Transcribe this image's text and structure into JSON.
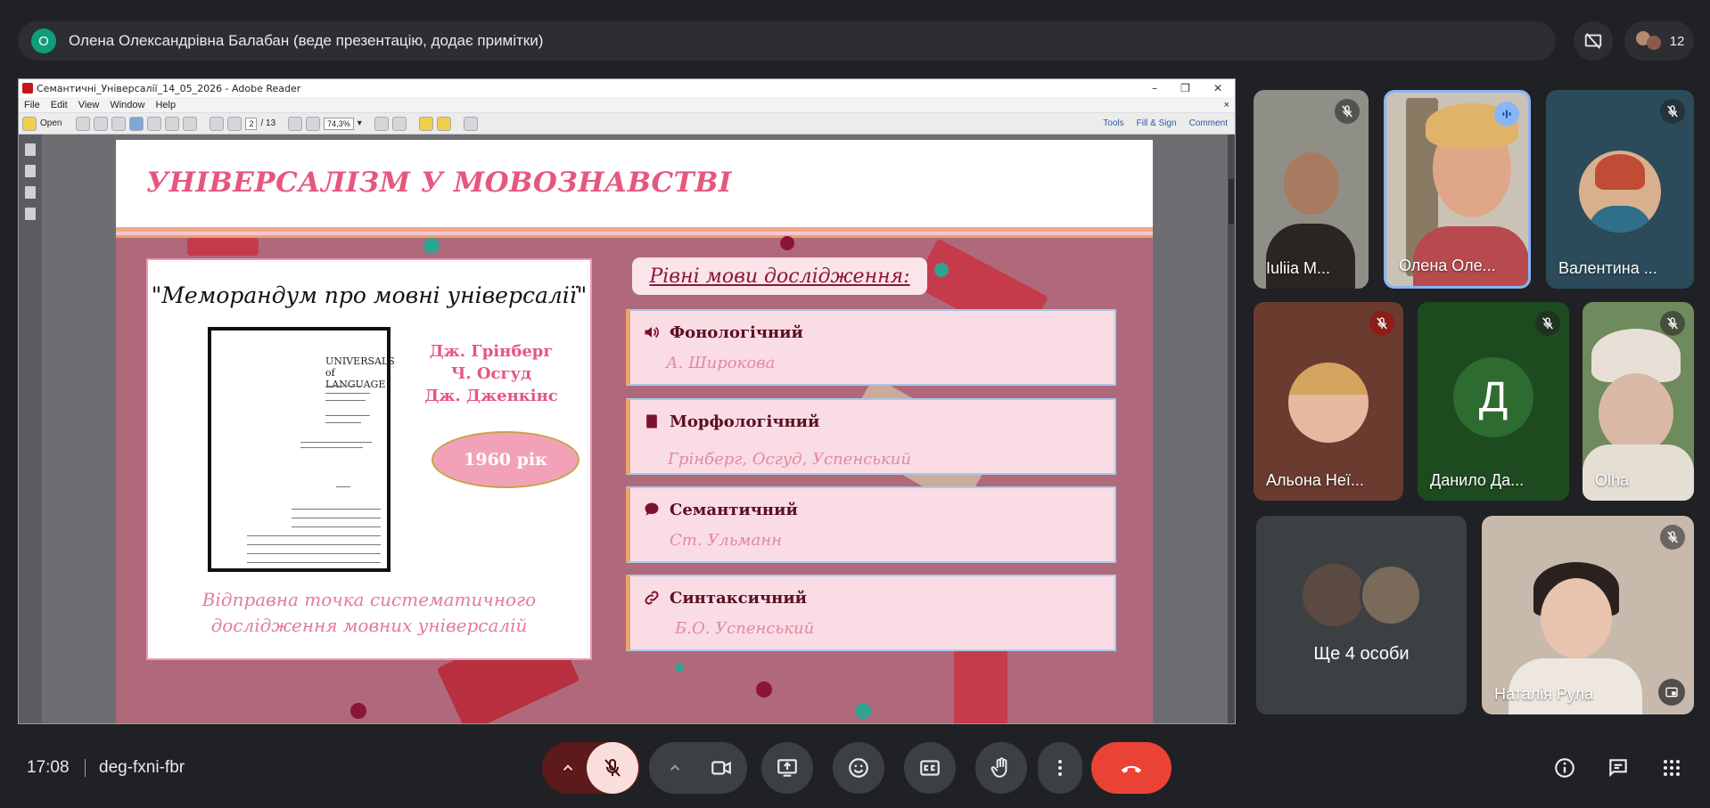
{
  "header": {
    "presenter_initial": "О",
    "presenter_text": "Олена Олександрівна Балабан (веде презентацію, додає примітки)",
    "people_count": "12"
  },
  "reader": {
    "window_title": "Семантичні_Універсалії_14_05_2026 - Adobe Reader",
    "menu": [
      "File",
      "Edit",
      "View",
      "Window",
      "Help"
    ],
    "open_label": "Open",
    "page_current": "2",
    "page_total": "/ 13",
    "zoom": "74,3%",
    "tools": "Tools",
    "fill_sign": "Fill & Sign",
    "comment": "Comment"
  },
  "slide": {
    "title": "УНІВЕРСАЛІЗМ У МОВОЗНАВСТВІ",
    "memo_title": "\"Меморандум про мовні універсалії\"",
    "book_title_1": "UNIVERSALS",
    "book_title_2": "of LANGUAGE",
    "authors": [
      "Дж. Грінберг",
      "Ч. Осгуд",
      "Дж. Дженкінс"
    ],
    "year": "1960 рік",
    "left_foot_1": "Відправна точка систематичного",
    "left_foot_2": "дослідження мовних універсалій",
    "levels_label": "Рівні мови дослідження:",
    "levels": [
      {
        "name": "Фонологічний",
        "authors": "А. Широкова",
        "icon": "speaker-icon"
      },
      {
        "name": "Морфологічний",
        "authors": "Грінберг, Осгуд,  Успенський",
        "icon": "bookmark-icon"
      },
      {
        "name": "Семантичний",
        "authors": "Ст. Ульманн",
        "icon": "speech-bubble-icon"
      },
      {
        "name": "Синтаксичний",
        "authors": "Б.О. Успенський",
        "icon": "link-icon"
      }
    ]
  },
  "participants": [
    {
      "name": "Iuliia M...",
      "muted": true
    },
    {
      "name": "Олена Оле...",
      "speaking": true
    },
    {
      "name": "Валентина ...",
      "muted": true
    },
    {
      "name": "Альона Неї...",
      "muted": true
    },
    {
      "name": "Данило Да...",
      "initial": "Д",
      "muted": true
    },
    {
      "name": "Olha",
      "muted": true
    },
    {
      "name": "Ще 4 особи"
    },
    {
      "name": "Наталія Рула",
      "muted": true
    }
  ],
  "footer": {
    "time": "17:08",
    "meeting_code": "deg-fxni-fbr"
  },
  "colors": {
    "bg": "#202124",
    "slide_bg": "#b0697a",
    "title_pink": "#e5577f",
    "end_call": "#ea4335",
    "mic_off_bg": "#f9dedc"
  }
}
